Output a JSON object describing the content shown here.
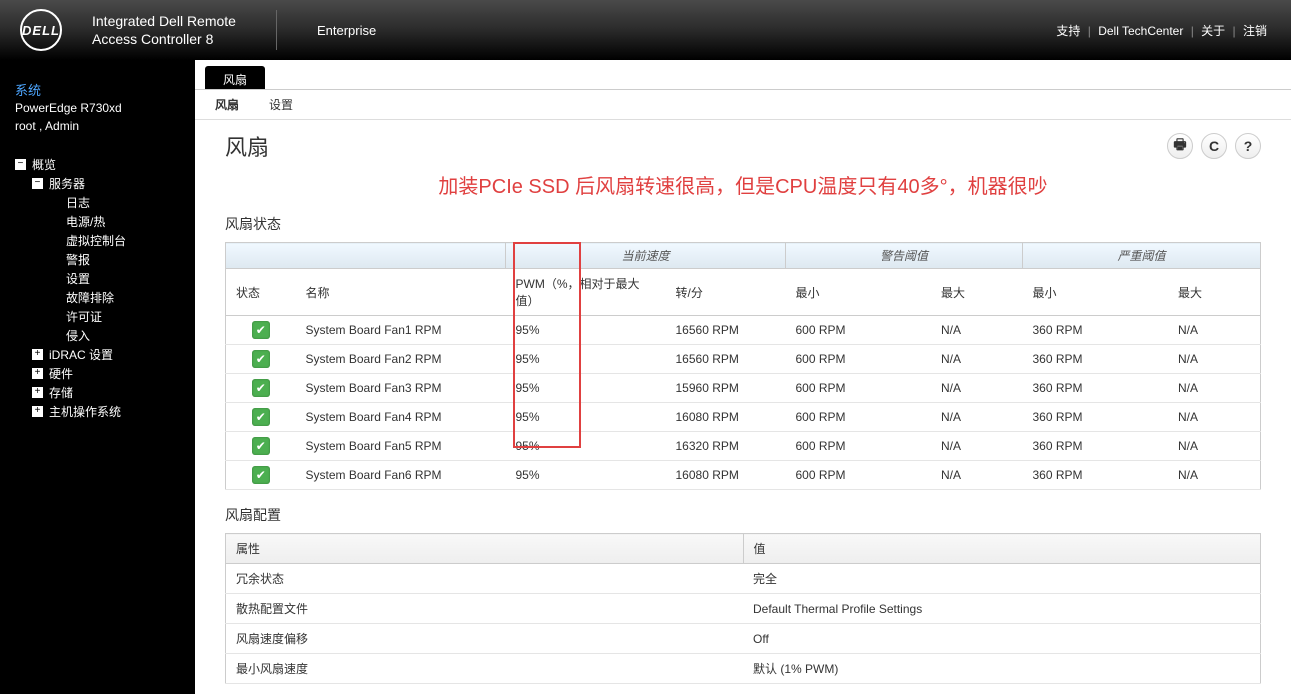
{
  "header": {
    "logo_text": "DELL",
    "title_line1": "Integrated Dell Remote",
    "title_line2": "Access Controller 8",
    "edition": "Enterprise",
    "links": {
      "support": "支持",
      "techcenter": "Dell TechCenter",
      "about": "关于",
      "logout": "注销"
    }
  },
  "sidebar": {
    "system_label": "系统",
    "model": "PowerEdge R730xd",
    "user": "root , Admin",
    "tree": {
      "overview": "概览",
      "server": "服务器",
      "logs": "日志",
      "power_thermal": "电源/热",
      "virtual_console": "虚拟控制台",
      "alerts": "警报",
      "settings": "设置",
      "troubleshoot": "故障排除",
      "license": "许可证",
      "intrusion": "侵入",
      "idrac_settings": "iDRAC 设置",
      "hardware": "硬件",
      "storage": "存储",
      "host_os": "主机操作系统"
    }
  },
  "tabs": {
    "main": "风扇",
    "sub1": "风扇",
    "sub2": "设置"
  },
  "page": {
    "title": "风扇",
    "annotation": "加装PCIe SSD 后风扇转速很高，但是CPU温度只有40多°，机器很吵",
    "fan_status_title": "风扇状态",
    "fan_config_title": "风扇配置"
  },
  "fan_table": {
    "group_headers": {
      "blank": "",
      "current_speed": "当前速度",
      "warning_threshold": "警告阈值",
      "critical_threshold": "严重阈值"
    },
    "headers": {
      "status": "状态",
      "name": "名称",
      "pwm": "PWM（%，相对于最大值）",
      "rpm": "转/分",
      "min": "最小",
      "max": "最大"
    },
    "rows": [
      {
        "name": "System Board Fan1 RPM",
        "pwm": "95%",
        "rpm": "16560 RPM",
        "warn_min": "600 RPM",
        "warn_max": "N/A",
        "crit_min": "360 RPM",
        "crit_max": "N/A"
      },
      {
        "name": "System Board Fan2 RPM",
        "pwm": "95%",
        "rpm": "16560 RPM",
        "warn_min": "600 RPM",
        "warn_max": "N/A",
        "crit_min": "360 RPM",
        "crit_max": "N/A"
      },
      {
        "name": "System Board Fan3 RPM",
        "pwm": "95%",
        "rpm": "15960 RPM",
        "warn_min": "600 RPM",
        "warn_max": "N/A",
        "crit_min": "360 RPM",
        "crit_max": "N/A"
      },
      {
        "name": "System Board Fan4 RPM",
        "pwm": "95%",
        "rpm": "16080 RPM",
        "warn_min": "600 RPM",
        "warn_max": "N/A",
        "crit_min": "360 RPM",
        "crit_max": "N/A"
      },
      {
        "name": "System Board Fan5 RPM",
        "pwm": "95%",
        "rpm": "16320 RPM",
        "warn_min": "600 RPM",
        "warn_max": "N/A",
        "crit_min": "360 RPM",
        "crit_max": "N/A"
      },
      {
        "name": "System Board Fan6 RPM",
        "pwm": "95%",
        "rpm": "16080 RPM",
        "warn_min": "600 RPM",
        "warn_max": "N/A",
        "crit_min": "360 RPM",
        "crit_max": "N/A"
      }
    ]
  },
  "config_table": {
    "headers": {
      "attribute": "属性",
      "value": "值"
    },
    "rows": [
      {
        "attr": "冗余状态",
        "val": "完全"
      },
      {
        "attr": "散热配置文件",
        "val": "Default Thermal Profile Settings"
      },
      {
        "attr": "风扇速度偏移",
        "val": "Off"
      },
      {
        "attr": "最小风扇速度",
        "val": "默认 (1% PWM)"
      }
    ]
  }
}
